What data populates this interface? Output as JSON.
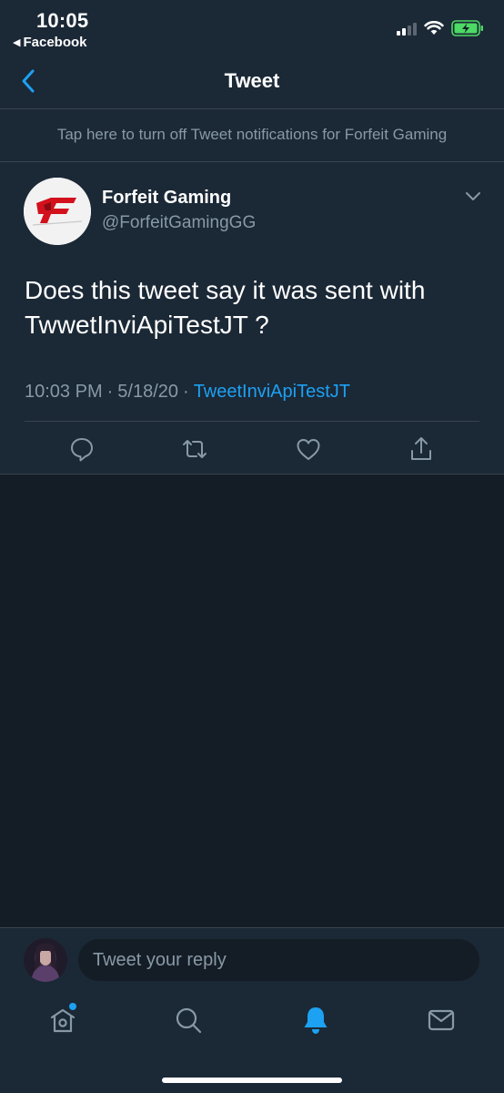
{
  "status_bar": {
    "time": "10:05",
    "back_app": "Facebook",
    "battery_color": "#4cd964"
  },
  "nav": {
    "title": "Tweet"
  },
  "notification_banner": "Tap here to turn off Tweet notifications for Forfeit Gaming",
  "tweet": {
    "author_name": "Forfeit Gaming",
    "author_handle": "@ForfeitGamingGG",
    "text": "Does this tweet say it was sent with TwwetInviApiTestJT ?",
    "time": "10:03 PM",
    "separator": "·",
    "date": "5/18/20",
    "source": "TweetInviApiTestJT"
  },
  "reply": {
    "placeholder": "Tweet your reply"
  },
  "tabbar": {
    "items": [
      "home-icon",
      "search-icon",
      "notifications-icon",
      "messages-icon"
    ],
    "active": "notifications-icon"
  },
  "colors": {
    "background": "#141d26",
    "surface": "#1b2836",
    "accent": "#1da1f2",
    "secondary_text": "#8899a6",
    "divider": "#38444d"
  }
}
